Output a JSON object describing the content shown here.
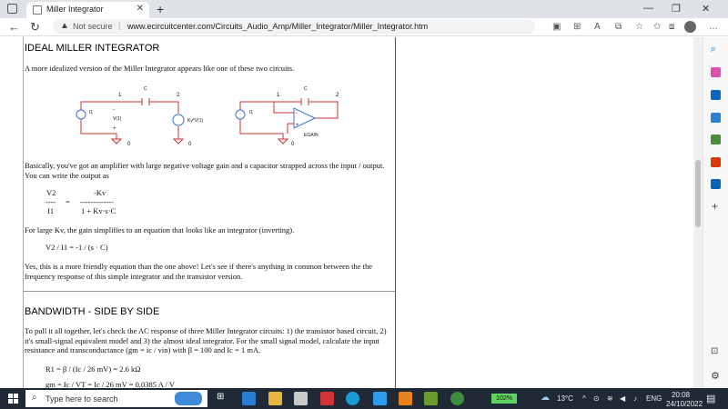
{
  "browser": {
    "tab_title": "Miller Integrator",
    "tab_close": "✕",
    "new_tab": "+",
    "not_secure": "Not secure",
    "url": "www.ecircuitcenter.com/Circuits_Audio_Amp/Miller_Integrator/Miller_Integrator.htm"
  },
  "article": {
    "heading1": "IDEAL MILLER INTEGRATOR",
    "intro": "A more idealized version of the Miller Integrator appears like one of these two circuits.",
    "circuit1": {
      "c": "C",
      "n1": "1",
      "n2": "2",
      "i1": "I1",
      "v1": "V(1)",
      "e": "Kv*V(1)",
      "gnd": "0",
      "minus": "-",
      "plus": "+"
    },
    "circuit2": {
      "c": "C",
      "n1": "1",
      "n2": "2",
      "i1": "I1",
      "egain": "EGAIN",
      "gnd": "0",
      "minus": "-",
      "plus": "+"
    },
    "para1": "Basically, you've got an amplifier with large negative voltage gain and a capacitor strapped across the input / output. You can write the output as",
    "eq1": {
      "num_left": "V2",
      "dash_left": "----",
      "den_left": "I1",
      "equals": "=",
      "num_right": "-Kv",
      "dash_right": "-------------",
      "den_right": "1 + Kv·s·C"
    },
    "para2": "For large Kv, the gain simplifies to an equation that looks like an integrator (inverting).",
    "eq2": "V2 / I1 = -1 / (s · C)",
    "para3": "Yes, this is a more friendly equation than the one above! Let's see if there's anything in common between the the frequency response of this simple integrator and the transistor version.",
    "heading2": "BANDWIDTH - SIDE BY SIDE",
    "para4": "To pull it all together, let's check the AC response of three Miller Integrator circuits: 1) the transistor based circuit, 2) it's small-signal equivalent model and 3) the almost ideal integrator. For the small signal model, calculate the input resistance and transconductance (gm = ic / vin) with β = 100 and Ic = 1 mA.",
    "eq3": "R1 = β / (Ic / 26 mV) = 2.6 kΩ",
    "eq4": "gm = Ic / VT = Ic / 26 mV = 0.0385 A / V"
  },
  "taskbar": {
    "search_placeholder": "Type here to search",
    "battery": "102%",
    "weather": "13°C",
    "lang": "ENG",
    "time": "20:08",
    "date": "24/10/2022"
  },
  "colors": {
    "accent": "#0078d4",
    "taskbar": "#1f2a36",
    "circuit": "#c33",
    "amp": "#3a6fd8"
  }
}
